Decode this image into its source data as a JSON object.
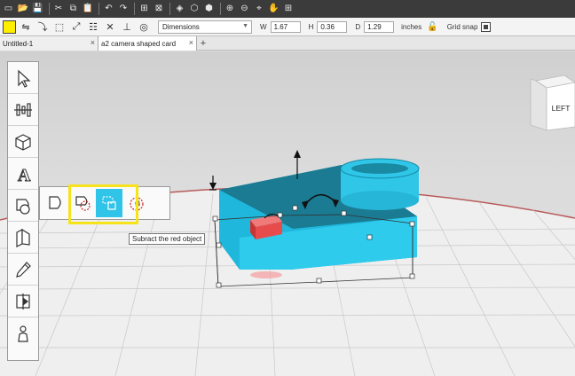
{
  "toolbar": {
    "buttons": [
      {
        "name": "new-icon",
        "glyph": "▭"
      },
      {
        "name": "open-icon",
        "glyph": "📂"
      },
      {
        "name": "save-icon",
        "glyph": "💾"
      },
      {
        "name": "cut-icon",
        "glyph": "✂"
      },
      {
        "name": "copy-icon",
        "glyph": "⧉"
      },
      {
        "name": "paste-icon",
        "glyph": "📋"
      },
      {
        "name": "undo-icon",
        "glyph": "↶"
      },
      {
        "name": "redo-icon",
        "glyph": "↷"
      },
      {
        "name": "group-icon",
        "glyph": "⊞"
      },
      {
        "name": "ungroup-icon",
        "glyph": "⊠"
      },
      {
        "name": "texture-icon",
        "glyph": "◈"
      },
      {
        "name": "view-solid-icon",
        "glyph": "⬡"
      },
      {
        "name": "view-wire-icon",
        "glyph": "⬢"
      },
      {
        "name": "zoom-in-icon",
        "glyph": "⊕"
      },
      {
        "name": "zoom-out-icon",
        "glyph": "⊖"
      },
      {
        "name": "zoom-fit-icon",
        "glyph": "⌖"
      },
      {
        "name": "pan-hand-icon",
        "glyph": "✋"
      },
      {
        "name": "frame-all-icon",
        "glyph": "⊞"
      }
    ]
  },
  "properties": {
    "color": "#ffee00",
    "dropdown_value": "Dimensions",
    "w_label": "W",
    "w_value": "1.67",
    "h_label": "H",
    "h_value": "0.36",
    "d_label": "D",
    "d_value": "1.29",
    "units": "inches",
    "grid_snap_label": "Grid snap"
  },
  "tabs": [
    {
      "label": "Untitled-1",
      "active": false
    },
    {
      "label": "a2 camera shaped card",
      "active": true
    }
  ],
  "tooltip": "Subract the red object",
  "view_cube": {
    "label": "LEFT"
  },
  "colors": {
    "accent_cyan": "#2fc4e8",
    "highlight_yellow": "#f7e31a",
    "red_object": "#e84b4b"
  }
}
